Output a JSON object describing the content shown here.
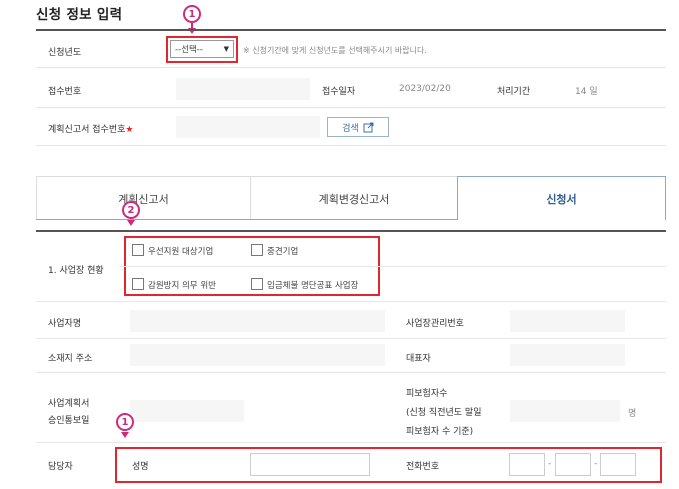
{
  "page_title": "신청 정보 입력",
  "row_year": {
    "label": "신청년도",
    "select_value": "--선택--",
    "hint": "※ 신청기간에 맞게 신청년도를 선택해주시기 바랍니다."
  },
  "row_receipt": {
    "label": "접수번호",
    "date_label": "접수일자",
    "date_value": "2023/02/20",
    "period_label": "처리기간",
    "period_value": "14 일"
  },
  "row_plan": {
    "label": "계획신고서 접수번호",
    "required_mark": "★",
    "search_label": "검색"
  },
  "tabs": [
    {
      "label": "계획신고서",
      "active": false
    },
    {
      "label": "계획변경신고서",
      "active": false
    },
    {
      "label": "신청서",
      "active": true
    }
  ],
  "section_status": {
    "label": "1. 사업장 현황",
    "checkboxes": [
      "우선지원 대상기업",
      "중견기업",
      "감원방지 의무 위반",
      "임금체불 명단공표 사업장"
    ]
  },
  "row_business": {
    "label": "사업자명",
    "right_label": "사업장관리번호"
  },
  "row_address": {
    "label": "소재지 주소",
    "right_label": "대표자"
  },
  "row_plan_confirm": {
    "label_line1": "사업계획서",
    "label_line2": "승인통보일",
    "right_label_line1": "피보험자수",
    "right_label_line2": "(신청 직전년도 말일",
    "right_label_line3": "피보험자 수 기준)",
    "unit": "명"
  },
  "row_manager": {
    "label": "담당자",
    "name_label": "성명",
    "phone_label": "전화번호",
    "sep": "-"
  },
  "annotations": {
    "marker_1": "1",
    "marker_2": "2"
  },
  "colors": {
    "highlight_red": "#e0262f",
    "marker_pink": "#cc2a7c",
    "active_tab": "#2f5f8f"
  }
}
